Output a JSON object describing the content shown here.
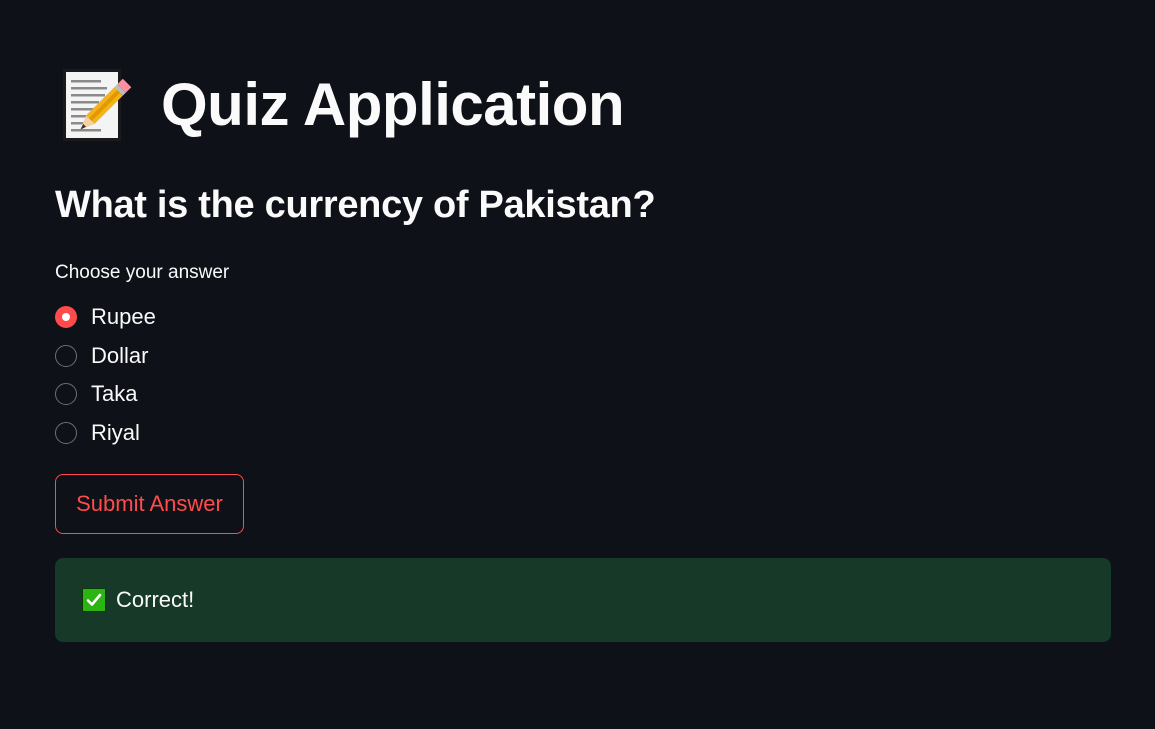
{
  "header": {
    "icon": "memo-icon",
    "title": "Quiz Application"
  },
  "quiz": {
    "question": "What is the currency of Pakistan?",
    "prompt": "Choose your answer",
    "options": [
      {
        "label": "Rupee",
        "selected": true
      },
      {
        "label": "Dollar",
        "selected": false
      },
      {
        "label": "Taka",
        "selected": false
      },
      {
        "label": "Riyal",
        "selected": false
      }
    ],
    "submit_label": "Submit Answer"
  },
  "result": {
    "icon": "check-mark-icon",
    "message": "Correct!"
  },
  "colors": {
    "background": "#0e1117",
    "accent": "#ff4b4b",
    "success_bg": "#173928",
    "text": "#fafafa"
  }
}
